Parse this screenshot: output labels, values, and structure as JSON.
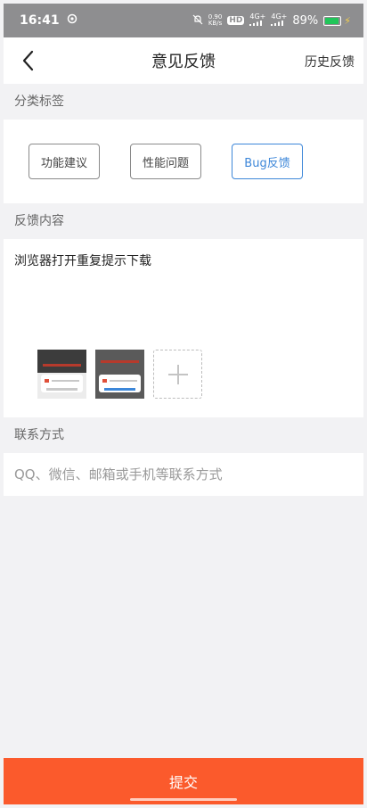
{
  "status_bar": {
    "time": "16:41",
    "net_speed_top": "0.90",
    "net_speed_bottom": "KB/s",
    "hd_label": "HD",
    "signal_1": "4G+",
    "signal_2": "4G+",
    "battery": "89%",
    "battery_level": 0.89,
    "icons": [
      "app-notification-icon",
      "mute-icon",
      "signal-icon",
      "battery-icon",
      "charging-icon"
    ]
  },
  "nav": {
    "title": "意见反馈",
    "history_label": "历史反馈",
    "back_icon": "chevron-left-icon"
  },
  "category": {
    "label": "分类标签",
    "tags": [
      {
        "label": "功能建议",
        "selected": false
      },
      {
        "label": "性能问题",
        "selected": false
      },
      {
        "label": "Bug反馈",
        "selected": true
      }
    ],
    "accent_color": "#3d87d9"
  },
  "feedback": {
    "label": "反馈内容",
    "text": "浏览器打开重复提示下载",
    "add_icon": "plus-icon"
  },
  "contact": {
    "label": "联系方式",
    "placeholder": "QQ、微信、邮箱或手机等联系方式",
    "value": ""
  },
  "submit": {
    "label": "提交",
    "color": "#fb5a2c"
  }
}
